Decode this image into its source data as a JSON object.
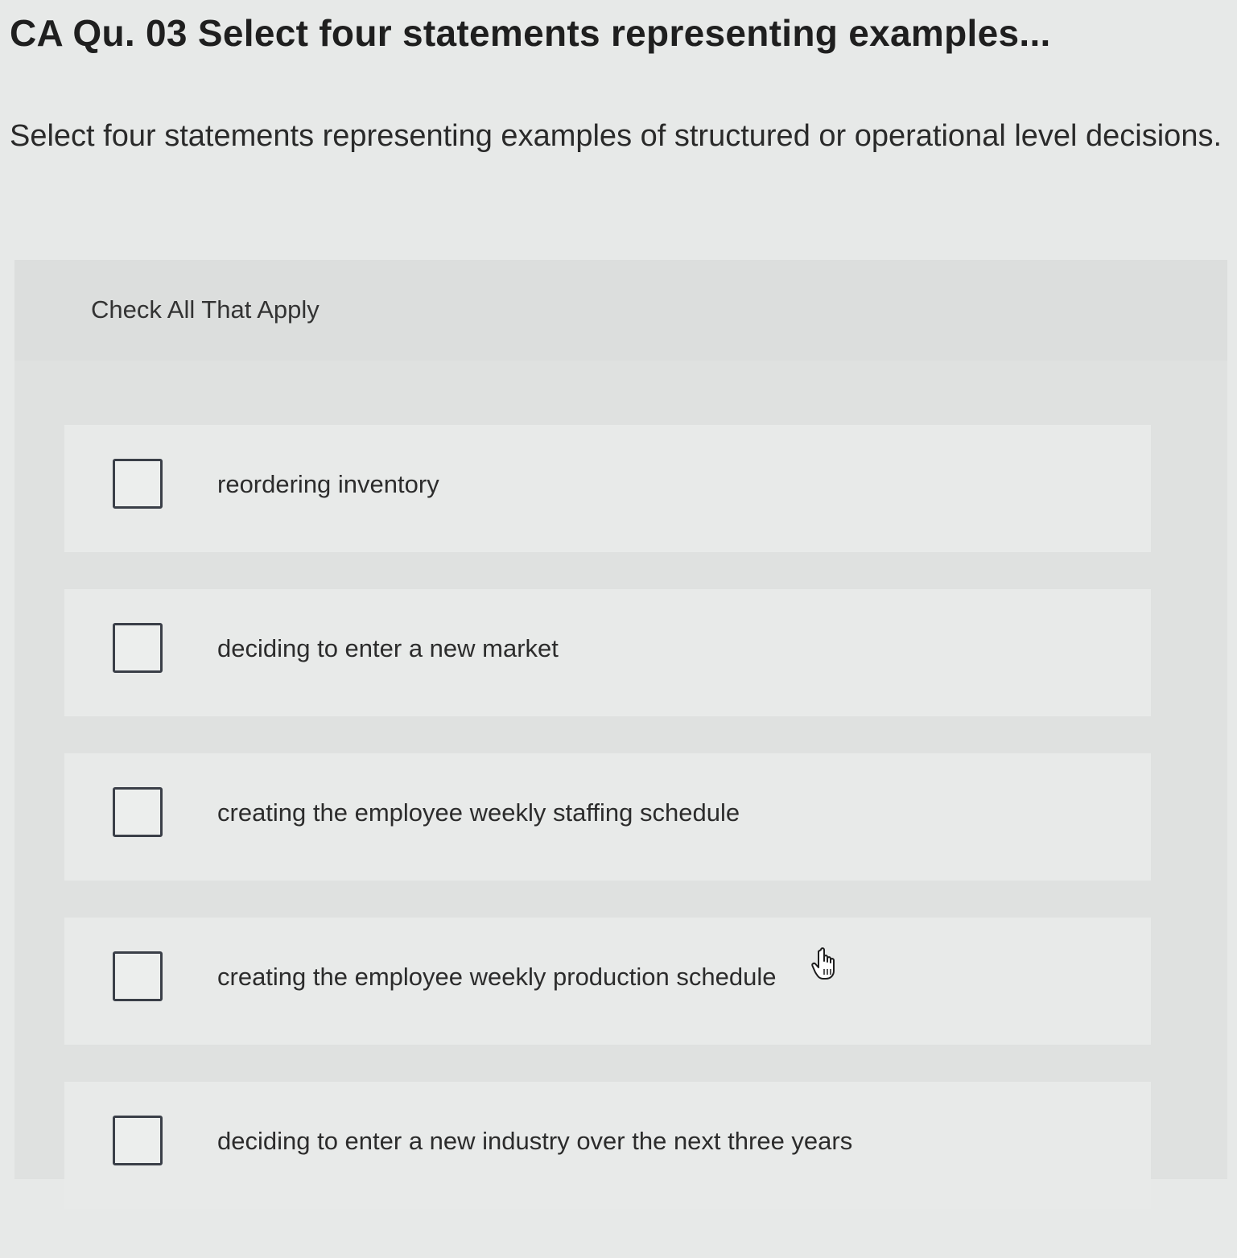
{
  "header": {
    "title": "CA Qu. 03 Select four statements representing examples..."
  },
  "question": {
    "prompt": "Select four statements representing examples of structured or operational level decisions."
  },
  "answer_panel": {
    "instruction": "Check All That Apply",
    "options": [
      {
        "label": "reordering inventory",
        "checked": false
      },
      {
        "label": "deciding to enter a new market",
        "checked": false
      },
      {
        "label": "creating the employee weekly staffing schedule",
        "checked": false
      },
      {
        "label": "creating the employee weekly production schedule",
        "checked": false
      },
      {
        "label": "deciding to enter a new industry over the next three years",
        "checked": false
      }
    ]
  },
  "icons": {
    "cursor": "hand-pointer-icon"
  }
}
